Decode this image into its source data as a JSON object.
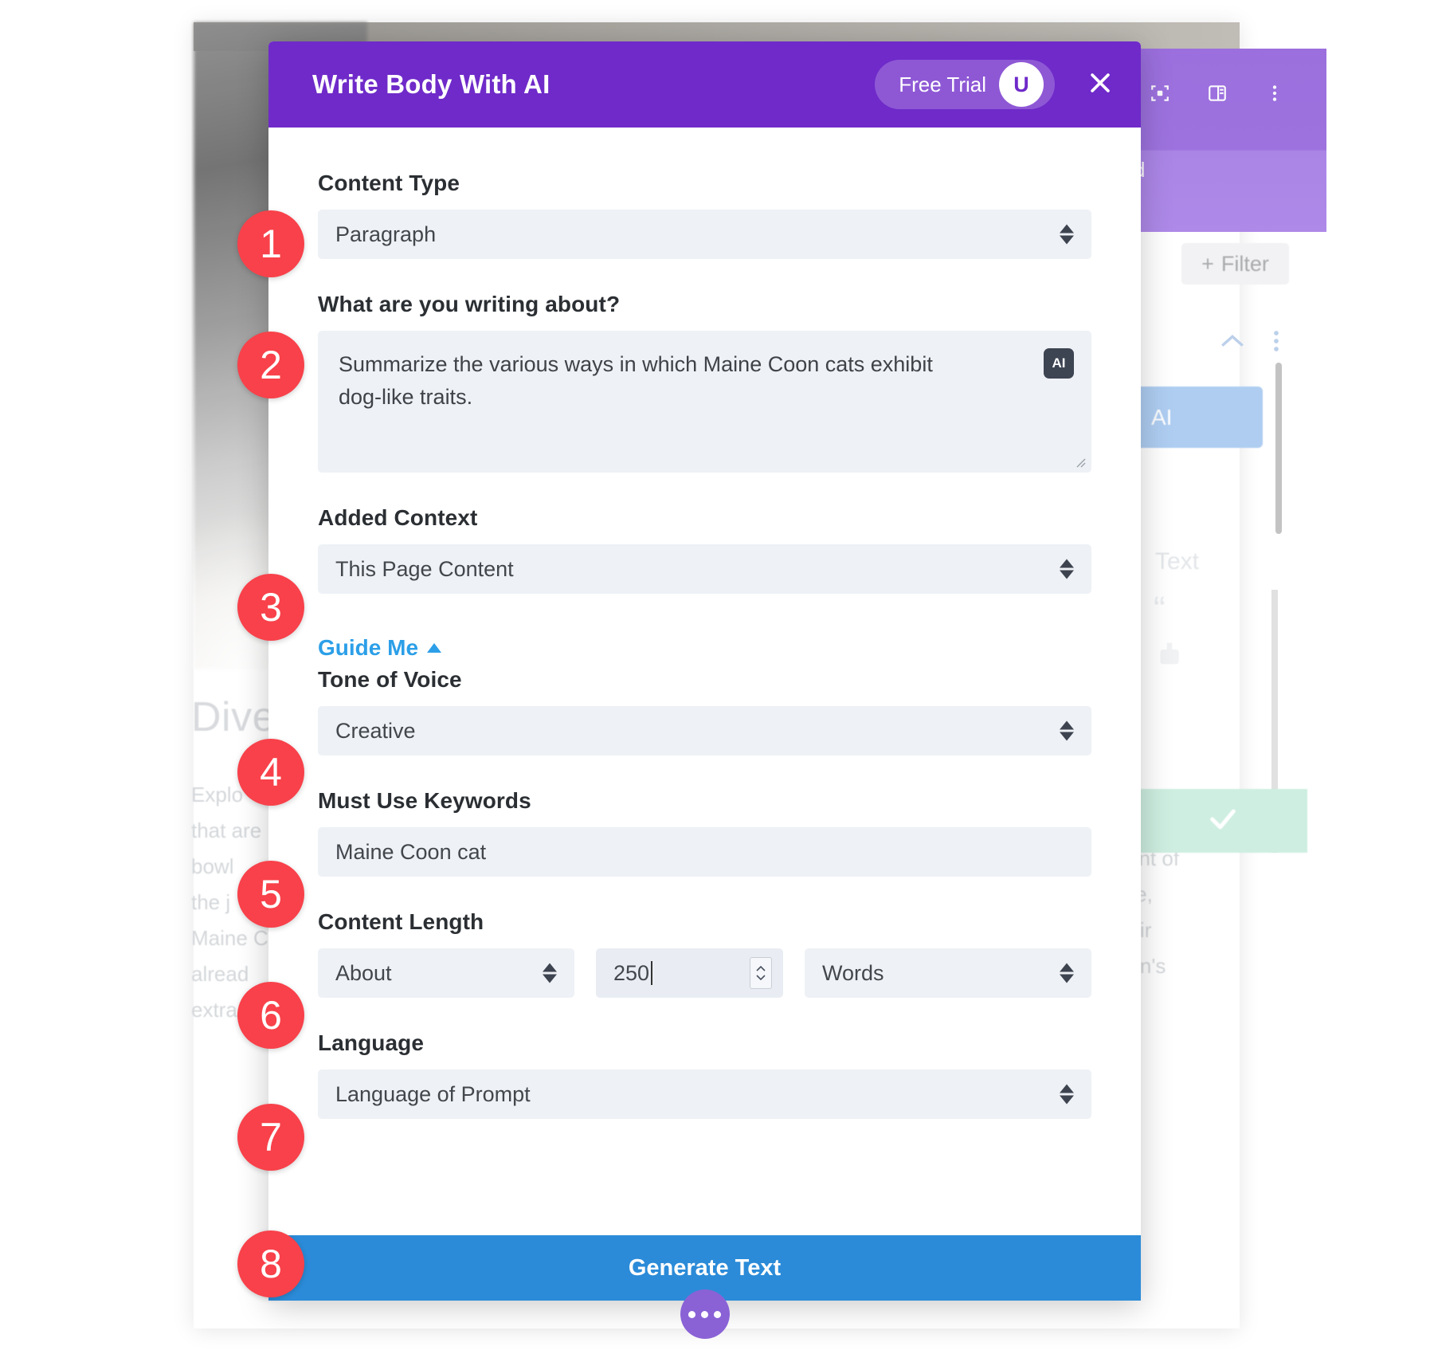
{
  "modal": {
    "title": "Write Body With AI",
    "trial_label": "Free Trial",
    "avatar_initial": "U",
    "close_icon": "close-icon",
    "fields": {
      "content_type": {
        "label": "Content Type",
        "value": "Paragraph"
      },
      "writing_about": {
        "label": "What are you writing about?",
        "value": "Summarize the various ways in which Maine Coon cats exhibit dog-like traits.",
        "ai_badge": "AI"
      },
      "added_context": {
        "label": "Added Context",
        "value": "This Page Content"
      },
      "guide_me": {
        "label": "Guide Me",
        "caret_icon": "caret-up-icon"
      },
      "tone_of_voice": {
        "label": "Tone of Voice",
        "value": "Creative"
      },
      "must_use_keywords": {
        "label": "Must Use Keywords",
        "value": "Maine Coon cat"
      },
      "content_length": {
        "label": "Content Length",
        "qualifier": "About",
        "amount": "250",
        "unit": "Words"
      },
      "language": {
        "label": "Language",
        "value": "Language of Prompt"
      }
    },
    "generate_button": "Generate Text",
    "fab_icon": "more-dots-icon"
  },
  "callouts": [
    {
      "number": "1"
    },
    {
      "number": "2"
    },
    {
      "number": "3"
    },
    {
      "number": "4"
    },
    {
      "number": "5"
    },
    {
      "number": "6"
    },
    {
      "number": "7"
    },
    {
      "number": "8"
    }
  ],
  "background": {
    "heading": "Dive",
    "body_left": "Explo that are bowl the j Maine C alread extra",
    "body_right": "cent of ure, heir oon's",
    "filter_button": "Filter",
    "text_label": "Text",
    "icons": {
      "focus": "focus-frame-icon",
      "layout": "layout-panel-icon",
      "menu": "more-vertical-icon",
      "plus": "plus-icon",
      "chevron_up": "chevron-up-icon",
      "quote": "quote-icon",
      "bucket": "paint-bucket-icon",
      "check": "check-icon"
    },
    "accent_purple": "#9b6fdd",
    "accent_blue": "#aecdf1",
    "accent_green": "#cdeee0"
  },
  "colors": {
    "header_purple": "#6f2ac9",
    "generate_blue": "#2b8bd8",
    "callout_red": "#f8414a",
    "link_blue": "#2c9fe8",
    "field_bg": "#eef1f5"
  }
}
